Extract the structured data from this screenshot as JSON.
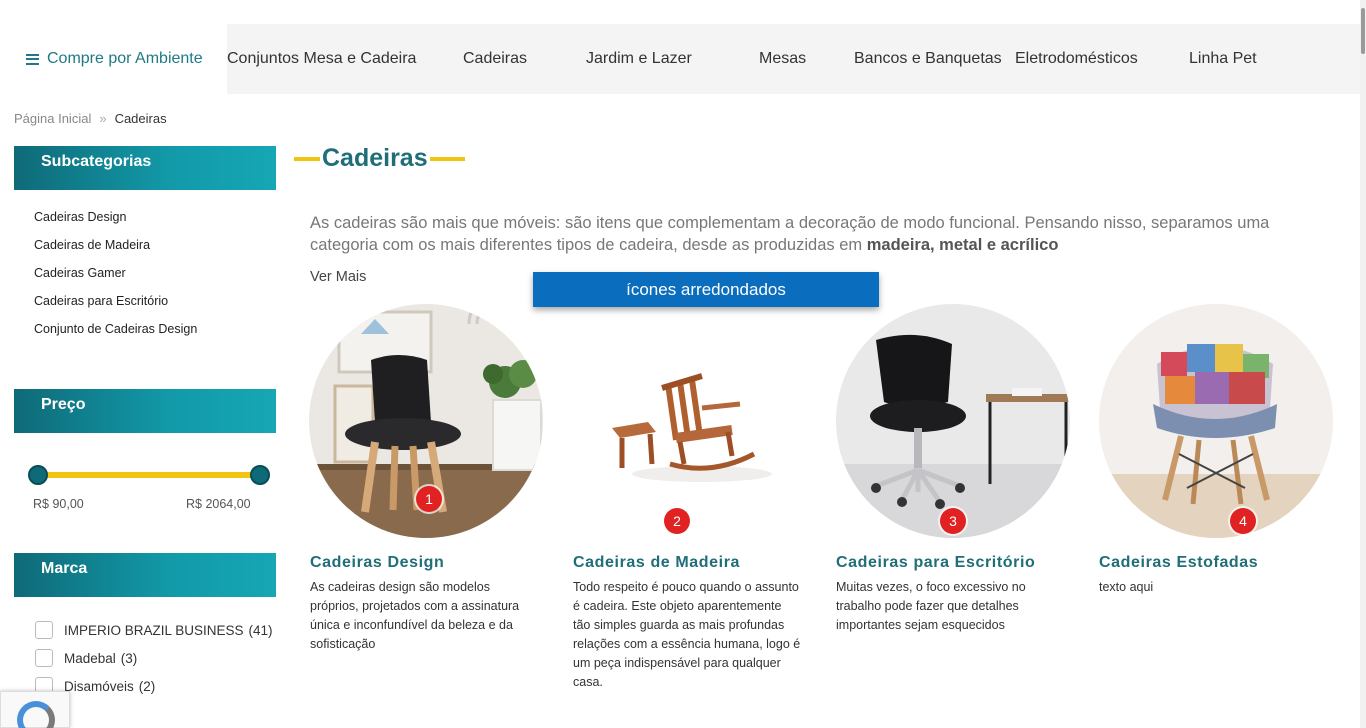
{
  "nav": {
    "ambiente_label": "Compre por Ambiente",
    "items": [
      "Conjuntos Mesa e Cadeira",
      "Cadeiras",
      "Jardim e Lazer",
      "Mesas",
      "Bancos e Banquetas",
      "Eletrodomésticos",
      "Linha Pet"
    ]
  },
  "breadcrumb": {
    "home": "Página Inicial",
    "separator": "»",
    "current": "Cadeiras"
  },
  "sidebar": {
    "subcategorias_title": "Subcategorias",
    "subcategorias": [
      "Cadeiras Design",
      "Cadeiras de Madeira",
      "Cadeiras Gamer",
      "Cadeiras para Escritório",
      "Conjunto de Cadeiras Design"
    ],
    "preco_title": "Preço",
    "price_min": "R$ 90,00",
    "price_max": "R$ 2064,00",
    "marca_title": "Marca",
    "brands": [
      {
        "name": "IMPERIO BRAZIL BUSINESS",
        "count": "(41)"
      },
      {
        "name": "Madebal",
        "count": "(3)"
      },
      {
        "name": "Disamóveis",
        "count": "(2)"
      }
    ]
  },
  "main": {
    "title": "Cadeiras",
    "intro_prefix": "As cadeiras são mais que móveis: são itens que complementam a decoração de modo funcional. Pensando nisso, separamos uma categoria com os mais diferentes tipos de cadeira, desde as produzidas em ",
    "intro_bold": "madeira, metal e acrílico",
    "ver_mais": "Ver Mais",
    "annotation": "ícones arredondados"
  },
  "cards": [
    {
      "badge": "1",
      "title": "Cadeiras Design",
      "desc": "As cadeiras design são modelos próprios, projetados com a assinatura única e inconfundível da beleza e da sofisticação"
    },
    {
      "badge": "2",
      "title": "Cadeiras de Madeira",
      "desc": "Todo respeito é pouco quando o assunto é cadeira. Este objeto aparentemente tão simples guarda as mais profundas relações com a essência humana, logo é um peça indispensável para qualquer casa."
    },
    {
      "badge": "3",
      "title": "Cadeiras para Escritório",
      "desc": "Muitas vezes, o foco excessivo no trabalho pode fazer que detalhes importantes sejam esquecidos"
    },
    {
      "badge": "4",
      "title": "Cadeiras Estofadas",
      "desc": "texto aqui"
    }
  ],
  "colors": {
    "accent": "#1f6e78",
    "highlight": "#f1c40f",
    "badge": "#e02222",
    "annotation": "#0b6dbd"
  }
}
